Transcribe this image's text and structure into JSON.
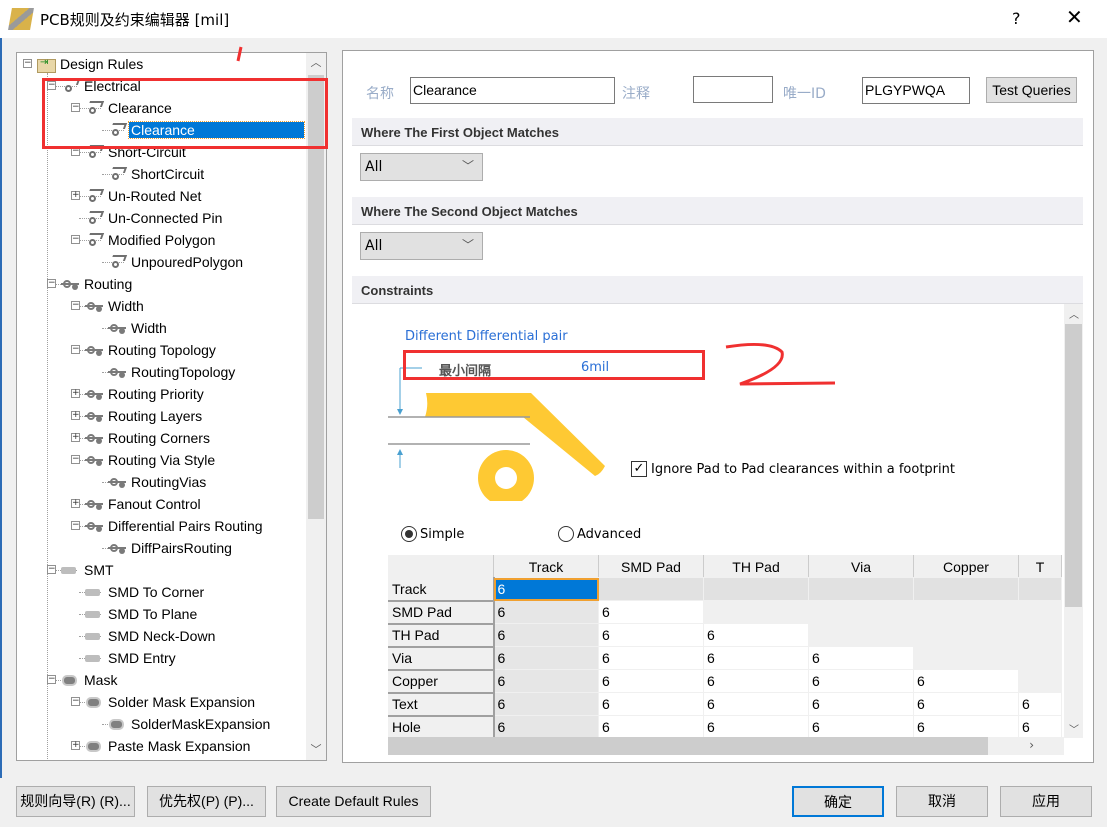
{
  "window": {
    "title": "PCB规则及约束编辑器 [mil]",
    "help": "?",
    "close": "✕"
  },
  "tree": {
    "items": [
      {
        "label": "Design Rules",
        "level": 0,
        "exp": "minus",
        "icon": "root"
      },
      {
        "label": "Electrical",
        "level": 1,
        "exp": "minus",
        "icon": "elec"
      },
      {
        "label": "Clearance",
        "level": 2,
        "exp": "minus",
        "icon": "elec"
      },
      {
        "label": "Clearance",
        "level": 3,
        "exp": "",
        "icon": "elec",
        "selected": true
      },
      {
        "label": "Short-Circuit",
        "level": 2,
        "exp": "minus",
        "icon": "elec"
      },
      {
        "label": "ShortCircuit",
        "level": 3,
        "exp": "",
        "icon": "elec"
      },
      {
        "label": "Un-Routed Net",
        "level": 2,
        "exp": "plus",
        "icon": "elec"
      },
      {
        "label": "Un-Connected Pin",
        "level": 2,
        "exp": "",
        "icon": "elec"
      },
      {
        "label": "Modified Polygon",
        "level": 2,
        "exp": "minus",
        "icon": "elec"
      },
      {
        "label": "UnpouredPolygon",
        "level": 3,
        "exp": "",
        "icon": "elec"
      },
      {
        "label": "Routing",
        "level": 1,
        "exp": "minus",
        "icon": "route"
      },
      {
        "label": "Width",
        "level": 2,
        "exp": "minus",
        "icon": "route"
      },
      {
        "label": "Width",
        "level": 3,
        "exp": "",
        "icon": "route"
      },
      {
        "label": "Routing Topology",
        "level": 2,
        "exp": "minus",
        "icon": "route"
      },
      {
        "label": "RoutingTopology",
        "level": 3,
        "exp": "",
        "icon": "route"
      },
      {
        "label": "Routing Priority",
        "level": 2,
        "exp": "plus",
        "icon": "route"
      },
      {
        "label": "Routing Layers",
        "level": 2,
        "exp": "plus",
        "icon": "route"
      },
      {
        "label": "Routing Corners",
        "level": 2,
        "exp": "plus",
        "icon": "route"
      },
      {
        "label": "Routing Via Style",
        "level": 2,
        "exp": "minus",
        "icon": "route"
      },
      {
        "label": "RoutingVias",
        "level": 3,
        "exp": "",
        "icon": "route"
      },
      {
        "label": "Fanout Control",
        "level": 2,
        "exp": "plus",
        "icon": "route"
      },
      {
        "label": "Differential Pairs Routing",
        "level": 2,
        "exp": "minus",
        "icon": "route"
      },
      {
        "label": "DiffPairsRouting",
        "level": 3,
        "exp": "",
        "icon": "route"
      },
      {
        "label": "SMT",
        "level": 1,
        "exp": "minus",
        "icon": "smt"
      },
      {
        "label": "SMD To Corner",
        "level": 2,
        "exp": "",
        "icon": "smt"
      },
      {
        "label": "SMD To Plane",
        "level": 2,
        "exp": "",
        "icon": "smt"
      },
      {
        "label": "SMD Neck-Down",
        "level": 2,
        "exp": "",
        "icon": "smt"
      },
      {
        "label": "SMD Entry",
        "level": 2,
        "exp": "",
        "icon": "smt"
      },
      {
        "label": "Mask",
        "level": 1,
        "exp": "minus",
        "icon": "mask"
      },
      {
        "label": "Solder Mask Expansion",
        "level": 2,
        "exp": "minus",
        "icon": "mask"
      },
      {
        "label": "SolderMaskExpansion",
        "level": 3,
        "exp": "",
        "icon": "mask"
      },
      {
        "label": "Paste Mask Expansion",
        "level": 2,
        "exp": "plus",
        "icon": "mask"
      }
    ]
  },
  "form": {
    "name_label": "名称",
    "name_value": "Clearance",
    "comment_label": "注释",
    "comment_value": "",
    "id_label": "唯一ID",
    "id_value": "PLGYPWQA",
    "test_queries": "Test Queries"
  },
  "first_match": {
    "title": "Where The First Object Matches",
    "value": "All"
  },
  "second_match": {
    "title": "Where The Second Object Matches",
    "value": "All"
  },
  "constraints": {
    "title": "Constraints",
    "diff_pair": "Different Differential pair",
    "min_clearance_label": "最小间隔",
    "min_clearance_value": "6mil",
    "ignore_pad": "Ignore Pad to Pad clearances within a footprint",
    "ignore_pad_checked": true,
    "mode_simple": "Simple",
    "mode_advanced": "Advanced",
    "mode_selected": "Simple",
    "columns": [
      "Track",
      "SMD Pad",
      "TH Pad",
      "Via",
      "Copper",
      "T"
    ],
    "rows": [
      {
        "label": "Track",
        "cells": [
          "6"
        ]
      },
      {
        "label": "SMD Pad",
        "cells": [
          "6",
          "6"
        ]
      },
      {
        "label": "TH Pad",
        "cells": [
          "6",
          "6",
          "6"
        ]
      },
      {
        "label": "Via",
        "cells": [
          "6",
          "6",
          "6",
          "6"
        ]
      },
      {
        "label": "Copper",
        "cells": [
          "6",
          "6",
          "6",
          "6",
          "6"
        ]
      },
      {
        "label": "Text",
        "cells": [
          "6",
          "6",
          "6",
          "6",
          "6",
          "6"
        ]
      },
      {
        "label": "Hole",
        "cells": [
          "6",
          "6",
          "6",
          "6",
          "6",
          "6"
        ]
      }
    ]
  },
  "annotations": {
    "mark1": "1",
    "mark2": "2",
    "color": "#f03030"
  },
  "buttons": {
    "wizard": "规则向导(R) (R)...",
    "priority": "优先权(P) (P)...",
    "create_default": "Create Default Rules",
    "ok": "确定",
    "cancel": "取消",
    "apply": "应用"
  },
  "colors": {
    "selection": "#0078d7",
    "copper": "#fec933",
    "label_blue": "#2a6fd6"
  }
}
